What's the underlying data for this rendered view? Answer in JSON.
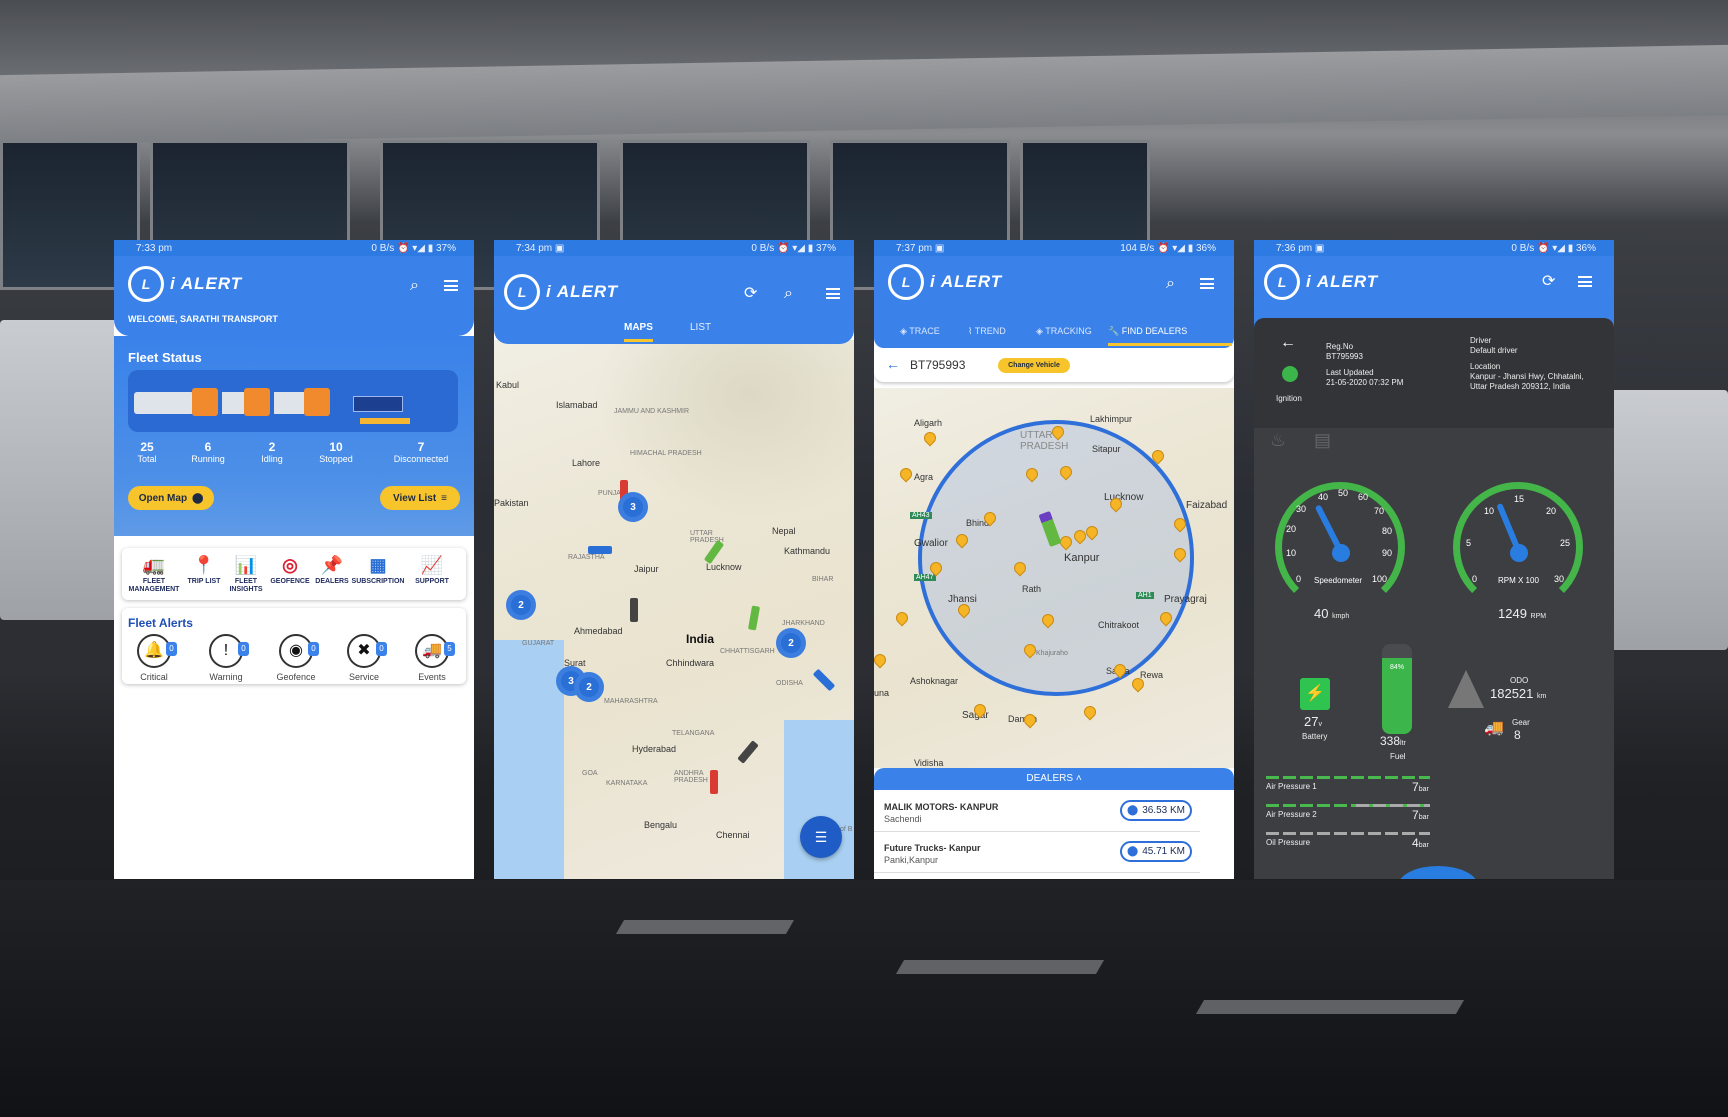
{
  "brand": {
    "logo_mark": "L",
    "logo_text": "i ALERT",
    "primary_color": "#3a82ea",
    "accent": "#f7c52b"
  },
  "phone1": {
    "status": {
      "time": "7:33 pm",
      "right": "0 B/s ⏰ ▾◢ ▮ 37%"
    },
    "welcome": "WELCOME, SARATHI TRANSPORT",
    "fleet_status_title": "Fleet Status",
    "stats": [
      {
        "value": "25",
        "label": "Total"
      },
      {
        "value": "6",
        "label": "Running"
      },
      {
        "value": "2",
        "label": "Idling"
      },
      {
        "value": "10",
        "label": "Stopped"
      },
      {
        "value": "7",
        "label": "Disconnected"
      }
    ],
    "open_map": "Open Map",
    "view_list": "View List",
    "quick": [
      {
        "icon": "fleet-management-icon",
        "glyph": "🚛",
        "label": "FLEET MANAGEMENT"
      },
      {
        "icon": "trip-list-icon",
        "glyph": "📍",
        "label": "TRIP LIST"
      },
      {
        "icon": "fleet-insights-icon",
        "glyph": "📊",
        "label": "FLEET INSIGHTS"
      },
      {
        "icon": "geofence-icon",
        "glyph": "◎",
        "label": "GEOFENCE"
      },
      {
        "icon": "dealers-icon",
        "glyph": "📌",
        "label": "DEALERS"
      },
      {
        "icon": "subscription-icon",
        "glyph": "▦",
        "label": "SUBSCRIPTION"
      },
      {
        "icon": "support-icon",
        "glyph": "📈",
        "label": "SUPPORT"
      }
    ],
    "alerts_title": "Fleet Alerts",
    "alerts": [
      {
        "icon": "critical-icon",
        "glyph": "🔔",
        "label": "Critical",
        "count": "0"
      },
      {
        "icon": "warning-icon",
        "glyph": "!",
        "label": "Warning",
        "count": "0"
      },
      {
        "icon": "geofence-alert-icon",
        "glyph": "◉",
        "label": "Geofence",
        "count": "0"
      },
      {
        "icon": "service-icon",
        "glyph": "✖",
        "label": "Service",
        "count": "0"
      },
      {
        "icon": "events-icon",
        "glyph": "🚚",
        "label": "Events",
        "count": "5"
      }
    ]
  },
  "phone2": {
    "status": {
      "time": "7:34 pm ▣",
      "right": "0 B/s ⏰ ▾◢ ▮ 37%"
    },
    "tabs": [
      {
        "label": "MAPS"
      },
      {
        "label": "LIST"
      }
    ],
    "places": {
      "kabul": "Kabul",
      "islamabad": "Islamabad",
      "jk": "JAMMU AND KASHMIR",
      "hp": "HIMACHAL PRADESH",
      "lahore": "Lahore",
      "pakistan": "Pakistan",
      "punjab": "PUNJA",
      "up": "UTTAR PRADESH",
      "nepal": "Nepal",
      "kathmandu": "Kathmandu",
      "lucknow": "Lucknow",
      "rajasthan": "RAJASTHA",
      "jaipur": "Jaipur",
      "bihar": "BIHAR",
      "ahmedabad": "Ahmedabad",
      "gujarat": "GUJARAT",
      "india": "India",
      "jharkhand": "JHARKHAND",
      "chhattisgarh": "CHHATTISGARH",
      "chhindwara": "Chhindwara",
      "odisha": "ODISHA",
      "surat": "Surat",
      "maharashtra": "MAHARASHTRA",
      "telangana": "TELANGANA",
      "hyderabad": "Hyderabad",
      "goa": "GOA",
      "karnataka": "KARNATAKA",
      "ap": "ANDHRA PRADESH",
      "bengaluru": "Bengalu",
      "chennai": "Chennai",
      "bay": "Bay of B"
    },
    "clusters": [
      "3",
      "2",
      "2",
      "3",
      "2"
    ]
  },
  "phone3": {
    "status": {
      "time": "7:37 pm ▣",
      "right": "104 B/s ⏰ ▾◢ ▮ 36%"
    },
    "tabs": [
      {
        "label": "TRACE"
      },
      {
        "label": "TREND"
      },
      {
        "label": "TRACKING"
      },
      {
        "label": "FIND DEALERS"
      }
    ],
    "vehicle": "BT795993",
    "change_vehicle": "Change Vehicle",
    "places": {
      "agra1": "Aligarh",
      "agra": "Agra",
      "up": "UTTAR PRADESH",
      "lakhimpur": "Lakhimpur",
      "sitapur": "Sitapur",
      "bhind": "Bhind",
      "lucknow": "Lucknow",
      "faizabad": "Faizabad",
      "gwalior": "Gwalior",
      "kanpur": "Kanpur",
      "rath": "Rath",
      "jhansi": "Jhansi",
      "prayagraj": "Prayagraj",
      "chitrakoot": "Chitrakoot",
      "khajuraho": "Khajuraho",
      "ashoknagar": "Ashoknagar",
      "satna": "Satna",
      "rewa": "Rewa",
      "sagar": "Sagar",
      "damoh": "Damoh",
      "guna": "una",
      "vidisha": "Vidisha",
      "ah43": "AH43",
      "ah47": "AH47",
      "ah1": "AH1"
    },
    "dealers_label": "DEALERS",
    "dealers": [
      {
        "name": "MALIK MOTORS- KANPUR",
        "area": "Sachendi",
        "distance": "36.53 KM"
      },
      {
        "name": "Future Trucks- Kanpur",
        "area": "Panki,Kanpur",
        "distance": "45.71 KM"
      }
    ]
  },
  "phone4": {
    "status": {
      "time": "7:36 pm ▣",
      "right": "0 B/s ⏰ ▾◢ ▮ 36%"
    },
    "reg_label": "Reg.No",
    "reg": "BT795993",
    "updated_label": "Last Updated",
    "updated": "21-05-2020 07:32 PM",
    "ignition": "Ignition",
    "driver_label": "Driver",
    "driver": "Default driver",
    "location_label": "Location",
    "location": "Kanpur - Jhansi Hwy, Chhatalni, Uttar Pradesh 209312, India",
    "speed_ticks": [
      "0",
      "10",
      "20",
      "30",
      "40",
      "50",
      "60",
      "70",
      "80",
      "90",
      "100"
    ],
    "speedometer": "Speedometer",
    "speed": "40",
    "speed_unit": "kmph",
    "speed_value": 40,
    "rpm_ticks": [
      "0",
      "5",
      "10",
      "15",
      "20",
      "25",
      "30"
    ],
    "rpm_label": "RPM X 100",
    "rpm": "1249",
    "rpm_unit": "RPM",
    "rpm_value": 12.49,
    "battery": "27",
    "battery_unit": "v",
    "battery_label": "Battery",
    "fuel_pct": "84%",
    "fuel": "338",
    "fuel_unit": "ltr",
    "fuel_label": "Fuel",
    "fuel_value": 0.84,
    "odo_label": "ODO",
    "odo": "182521",
    "odo_unit": "km",
    "gear_label": "Gear",
    "gear": "8",
    "pressures": [
      {
        "label": "Air Pressure 1",
        "value": "7",
        "unit": "bar",
        "level": 1.0
      },
      {
        "label": "Air Pressure 2",
        "value": "7",
        "unit": "bar",
        "level": 0.55
      },
      {
        "label": "Oil Pressure",
        "value": "4",
        "unit": "bar",
        "level": 0.0
      }
    ]
  }
}
